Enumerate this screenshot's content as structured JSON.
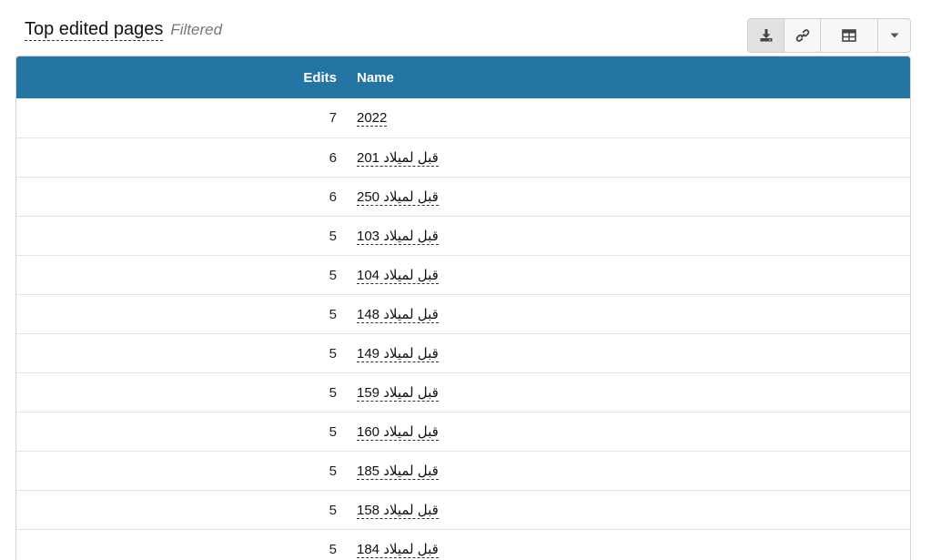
{
  "header": {
    "title": "Top edited pages",
    "filter_label": "Filtered"
  },
  "toolbar": {
    "download_icon": "download-icon",
    "link_icon": "link-icon",
    "table_icon": "table-icon",
    "caret_icon": "caret-down-icon"
  },
  "table": {
    "columns": [
      "Edits",
      "Name"
    ],
    "rows": [
      {
        "edits": "7",
        "name": "2022"
      },
      {
        "edits": "6",
        "name": "201 قبل لميلاد"
      },
      {
        "edits": "6",
        "name": "250 قبل لميلاد"
      },
      {
        "edits": "5",
        "name": "103 قبل لميلاد"
      },
      {
        "edits": "5",
        "name": "104 قبل لميلاد"
      },
      {
        "edits": "5",
        "name": "148 قبل لميلاد"
      },
      {
        "edits": "5",
        "name": "149 قبل لميلاد"
      },
      {
        "edits": "5",
        "name": "159 قبل لميلاد"
      },
      {
        "edits": "5",
        "name": "160 قبل لميلاد"
      },
      {
        "edits": "5",
        "name": "185 قبل لميلاد"
      },
      {
        "edits": "5",
        "name": "158 قبل لميلاد"
      },
      {
        "edits": "5",
        "name": "184 قبل لميلاد"
      }
    ]
  },
  "colors": {
    "header_bg": "#2474a4",
    "header_text": "#ffffff",
    "row_border": "#e4e4e4"
  }
}
